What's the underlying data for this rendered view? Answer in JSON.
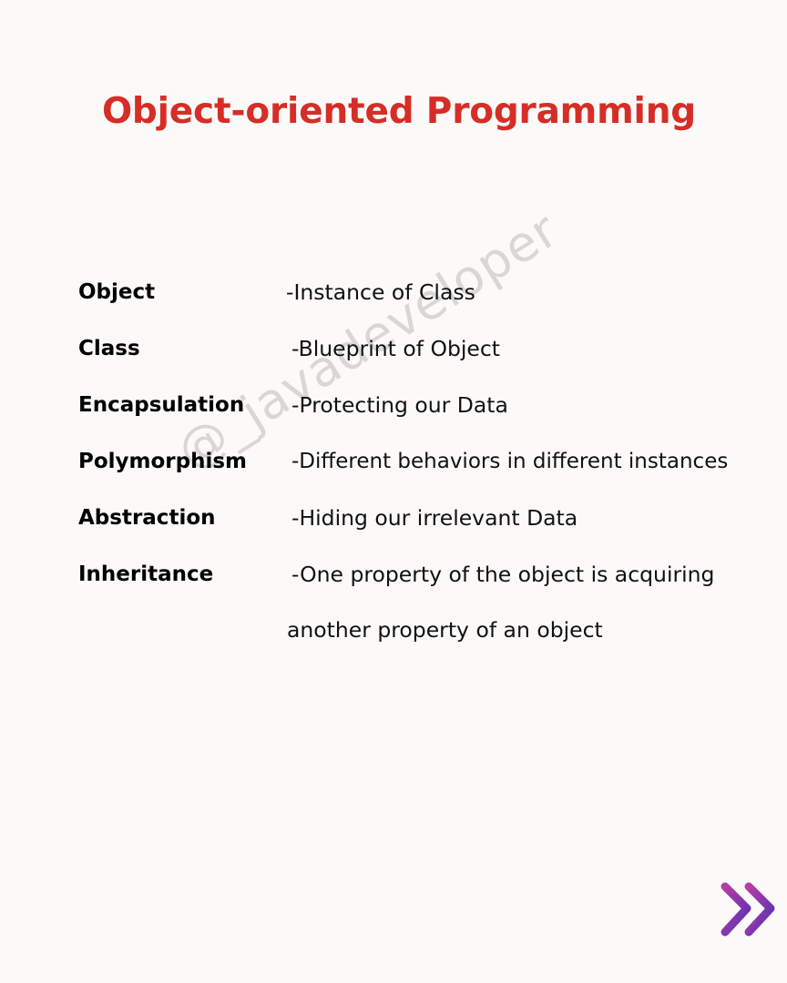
{
  "title": "Object-oriented Programming",
  "rows": [
    {
      "term": "Object",
      "definition": "-Instance of Class"
    },
    {
      "term": "Class",
      "definition": "-Blueprint of Object"
    },
    {
      "term": "Encapsulation",
      "definition": "-Protecting our Data"
    },
    {
      "term": "Polymorphism",
      "definition": "-Different behaviors in different instances"
    },
    {
      "term": "Abstraction",
      "definition": "-Hiding our irrelevant Data"
    },
    {
      "term": "Inheritance",
      "definition": "-One property of the object is acquiring"
    }
  ],
  "inheritance_continuation": "another property of an object",
  "watermark": "@_javadeveloper",
  "next_icon": "double-chevron-right-icon",
  "colors": {
    "title": "#d72d27",
    "background": "#fcfaf9",
    "icon_gradient_start": "#9b2fa0",
    "icon_gradient_end": "#5a2fb5"
  }
}
